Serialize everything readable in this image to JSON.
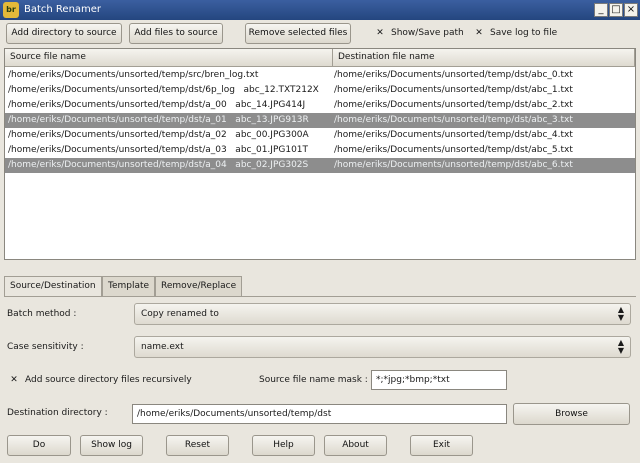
{
  "window": {
    "title": "Batch Renamer",
    "icon_text": "br",
    "controls": {
      "minimize": "_",
      "maximize": "□",
      "close": "×"
    }
  },
  "toolbar": {
    "add_directory": "Add directory to source",
    "add_files": "Add files to source",
    "remove_selected": "Remove selected files",
    "show_save_path": {
      "label": "Show/Save path",
      "checked": true
    },
    "save_log": {
      "label": "Save log to file",
      "checked": true
    }
  },
  "file_list": {
    "columns": [
      "Source file name",
      "Destination file name"
    ],
    "rows": [
      {
        "source": "/home/eriks/Documents/unsorted/temp/src/bren_log.txt",
        "destination": "/home/eriks/Documents/unsorted/temp/dst/abc_0.txt",
        "selected": false
      },
      {
        "source": "/home/eriks/Documents/unsorted/temp/dst/6p_log   abc_12.TXT212X",
        "destination": "/home/eriks/Documents/unsorted/temp/dst/abc_1.txt",
        "selected": false
      },
      {
        "source": "/home/eriks/Documents/unsorted/temp/dst/a_00   abc_14.JPG414J",
        "destination": "/home/eriks/Documents/unsorted/temp/dst/abc_2.txt",
        "selected": false
      },
      {
        "source": "/home/eriks/Documents/unsorted/temp/dst/a_01   abc_13.JPG913R",
        "destination": "/home/eriks/Documents/unsorted/temp/dst/abc_3.txt",
        "selected": true
      },
      {
        "source": "/home/eriks/Documents/unsorted/temp/dst/a_02   abc_00.JPG300A",
        "destination": "/home/eriks/Documents/unsorted/temp/dst/abc_4.txt",
        "selected": false
      },
      {
        "source": "/home/eriks/Documents/unsorted/temp/dst/a_03   abc_01.JPG101T",
        "destination": "/home/eriks/Documents/unsorted/temp/dst/abc_5.txt",
        "selected": false
      },
      {
        "source": "/home/eriks/Documents/unsorted/temp/dst/a_04   abc_02.JPG302S",
        "destination": "/home/eriks/Documents/unsorted/temp/dst/abc_6.txt",
        "selected": true
      }
    ]
  },
  "tabs": [
    "Source/Destination",
    "Template",
    "Remove/Replace"
  ],
  "form": {
    "batch_method": {
      "label": "Batch method :",
      "value": "Copy renamed to"
    },
    "case_sensitivity": {
      "label": "Case sensitivity :",
      "value": "name.ext"
    },
    "recursive": {
      "label": "Add source directory files recursively",
      "checked": true
    },
    "mask": {
      "label": "Source file name mask :",
      "value": "*;*jpg;*bmp;*txt"
    },
    "destination": {
      "label": "Destination directory :",
      "value": "/home/eriks/Documents/unsorted/temp/dst"
    },
    "browse": "Browse"
  },
  "bottom_buttons": [
    "Do",
    "Show log",
    "Reset",
    "Help",
    "About",
    "Exit"
  ],
  "colors": {
    "titlebar": "#24467f",
    "selection": "#8d8d8d",
    "window_bg": "#e9e6de"
  }
}
